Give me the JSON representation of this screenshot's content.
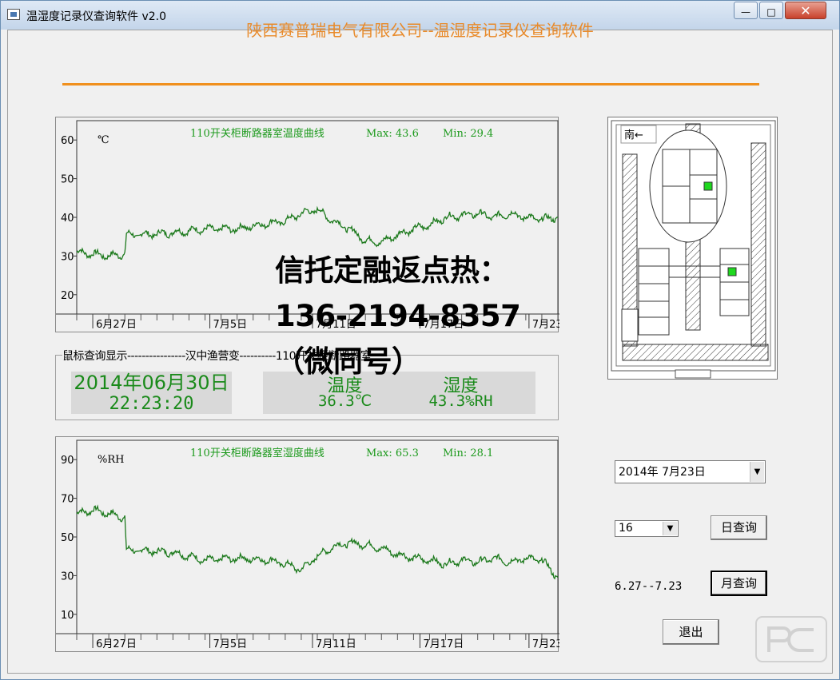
{
  "window": {
    "title": "温湿度记录仪查询软件  v2.0",
    "minimize_glyph": "—",
    "maximize_glyph": "□",
    "close_glyph": "✕"
  },
  "heading": "陕西赛普瑞电气有限公司--温湿度记录仪查询软件",
  "temperature_chart": {
    "title": "110开关柜断路器室温度曲线",
    "max_label": "Max: 43.6",
    "min_label": "Min: 29.4",
    "unit": "℃",
    "y_ticks": [
      "60",
      "50",
      "40",
      "30",
      "20"
    ],
    "x_ticks": [
      "6月27日",
      "7月5日",
      "7月11日",
      "7月17日",
      "7月23日"
    ]
  },
  "humidity_chart": {
    "title": "110开关柜断路器室湿度曲线",
    "max_label": "Max: 65.3",
    "min_label": "Min: 28.1",
    "unit": "%RH",
    "y_ticks": [
      "90",
      "70",
      "50",
      "30",
      "10"
    ],
    "x_ticks": [
      "6月27日",
      "7月5日",
      "7月11日",
      "7月17日",
      "7月23日"
    ]
  },
  "info_group": {
    "legend": "鼠标查询显示----------------汉中渔营变----------110开关柜断路器室",
    "date": "2014年06月30日",
    "time": "22:23:20",
    "temp_header": "温度",
    "temp_value": "36.3℃",
    "humidity_header": "湿度",
    "humidity_value": "43.3%RH"
  },
  "floor_plan": {
    "south_label": "南←"
  },
  "controls": {
    "date_value": "2014年 7月23日",
    "hour_value": "16",
    "day_query": "日查询",
    "month_query": "月查询",
    "range": "6.27--7.23",
    "exit": "退出"
  },
  "overlay_text": "信托定融返点热：136-2194-8357（微同号）",
  "chart_data": [
    {
      "type": "line",
      "title": "110开关柜断路器室温度曲线",
      "ylabel": "℃",
      "ylim": [
        15,
        65
      ],
      "y_ticks": [
        60,
        50,
        40,
        30,
        20
      ],
      "x_tick_labels": [
        "6月27日",
        "7月5日",
        "7月11日",
        "7月17日",
        "7月23日"
      ],
      "series": [
        {
          "x_days": [
            0,
            1,
            2,
            3,
            3.1,
            4,
            6,
            8,
            10,
            12,
            13,
            14,
            15,
            16,
            17,
            18,
            19,
            20,
            21,
            22,
            23,
            24,
            25,
            26,
            27,
            28,
            29,
            30
          ],
          "values": [
            31,
            30.5,
            30,
            30.5,
            35.5,
            35.5,
            36,
            37,
            37,
            38.5,
            39,
            41,
            42,
            39,
            37,
            34,
            33.5,
            35.5,
            37,
            38,
            40,
            40.5,
            41,
            40,
            41,
            40,
            39.5,
            40
          ],
          "color": "#1d7a1d"
        }
      ],
      "summary": {
        "max": 43.6,
        "min": 29.4
      }
    },
    {
      "type": "line",
      "title": "110开关柜断路器室湿度曲线",
      "ylabel": "%RH",
      "ylim": [
        0,
        100
      ],
      "y_ticks": [
        90,
        70,
        50,
        30,
        10
      ],
      "x_tick_labels": [
        "6月27日",
        "7月5日",
        "7月11日",
        "7月17日",
        "7月23日"
      ],
      "series": [
        {
          "x_days": [
            0,
            1,
            2,
            3,
            3.1,
            4,
            6,
            8,
            10,
            12,
            13,
            14,
            15,
            16,
            17,
            18,
            19,
            20,
            21,
            22,
            23,
            24,
            25,
            26,
            27,
            28,
            29,
            30
          ],
          "values": [
            62,
            64,
            62,
            60,
            43,
            43,
            42,
            38,
            39,
            38,
            36,
            33,
            40,
            45,
            47,
            46,
            44,
            41,
            39,
            38,
            36,
            38,
            37,
            39,
            37,
            39,
            38,
            29
          ],
          "color": "#1d7a1d"
        }
      ],
      "summary": {
        "max": 65.3,
        "min": 28.1
      }
    }
  ]
}
